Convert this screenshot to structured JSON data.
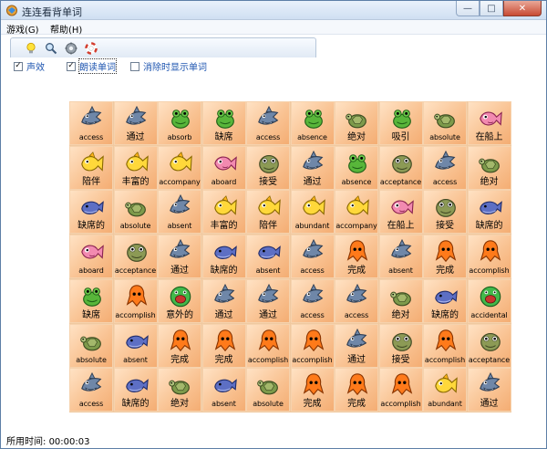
{
  "window": {
    "title": "连连看背单词",
    "controls": {
      "minimize": "—",
      "maximize": "□",
      "close": "✕"
    }
  },
  "menu": [
    {
      "label": "游戏(G)"
    },
    {
      "label": "帮助(H)"
    }
  ],
  "toolbar": [
    {
      "icon": "lightbulb-icon"
    },
    {
      "icon": "magnifier-icon"
    },
    {
      "icon": "gear-icon"
    },
    {
      "icon": "lifebuoy-icon"
    }
  ],
  "options": [
    {
      "label": "声效",
      "checked": true
    },
    {
      "label": "朗读单词",
      "checked": true
    },
    {
      "label": "消除时显示单词",
      "checked": false
    }
  ],
  "board": {
    "rows": [
      [
        {
          "word": "access",
          "creature": "shark"
        },
        {
          "word": "通过",
          "creature": "shark"
        },
        {
          "word": "absorb",
          "creature": "frog"
        },
        {
          "word": "缺席",
          "creature": "frog"
        },
        {
          "word": "access",
          "creature": "shark"
        },
        {
          "word": "absence",
          "creature": "frog"
        },
        {
          "word": "绝对",
          "creature": "turtle"
        },
        {
          "word": "吸引",
          "creature": "frog"
        },
        {
          "word": "absolute",
          "creature": "turtle"
        },
        {
          "word": "在船上",
          "creature": "pinkfish"
        }
      ],
      [
        {
          "word": "陪伴",
          "creature": "yellowfish"
        },
        {
          "word": "丰富的",
          "creature": "yellowfish"
        },
        {
          "word": "accompany",
          "creature": "yellowfish"
        },
        {
          "word": "aboard",
          "creature": "pinkfish"
        },
        {
          "word": "接受",
          "creature": "toad"
        },
        {
          "word": "通过",
          "creature": "shark"
        },
        {
          "word": "absence",
          "creature": "frog"
        },
        {
          "word": "acceptance",
          "creature": "toad"
        },
        {
          "word": "access",
          "creature": "shark"
        },
        {
          "word": "绝对",
          "creature": "turtle"
        }
      ],
      [
        {
          "word": "缺席的",
          "creature": "whale"
        },
        {
          "word": "absolute",
          "creature": "turtle"
        },
        {
          "word": "absent",
          "creature": "shark"
        },
        {
          "word": "丰富的",
          "creature": "yellowfish"
        },
        {
          "word": "陪伴",
          "creature": "yellowfish"
        },
        {
          "word": "abundant",
          "creature": "yellowfish"
        },
        {
          "word": "accompany",
          "creature": "yellowfish"
        },
        {
          "word": "在船上",
          "creature": "pinkfish"
        },
        {
          "word": "接受",
          "creature": "toad"
        },
        {
          "word": "缺席的",
          "creature": "whale"
        }
      ],
      [
        {
          "word": "aboard",
          "creature": "pinkfish"
        },
        {
          "word": "acceptance",
          "creature": "toad"
        },
        {
          "word": "通过",
          "creature": "shark"
        },
        {
          "word": "缺席的",
          "creature": "whale"
        },
        {
          "word": "absent",
          "creature": "whale"
        },
        {
          "word": "access",
          "creature": "shark"
        },
        {
          "word": "完成",
          "creature": "squid"
        },
        {
          "word": "absent",
          "creature": "shark"
        },
        {
          "word": "完成",
          "creature": "squid"
        },
        {
          "word": "accomplish",
          "creature": "squid"
        }
      ],
      [
        {
          "word": "缺席",
          "creature": "frog"
        },
        {
          "word": "accomplish",
          "creature": "squid"
        },
        {
          "word": "意外的",
          "creature": "greenball"
        },
        {
          "word": "通过",
          "creature": "shark"
        },
        {
          "word": "通过",
          "creature": "shark"
        },
        {
          "word": "access",
          "creature": "shark"
        },
        {
          "word": "access",
          "creature": "shark"
        },
        {
          "word": "绝对",
          "creature": "turtle"
        },
        {
          "word": "缺席的",
          "creature": "whale"
        },
        {
          "word": "accidental",
          "creature": "greenball"
        }
      ],
      [
        {
          "word": "absolute",
          "creature": "turtle"
        },
        {
          "word": "absent",
          "creature": "whale"
        },
        {
          "word": "完成",
          "creature": "squid"
        },
        {
          "word": "完成",
          "creature": "squid"
        },
        {
          "word": "accomplish",
          "creature": "squid"
        },
        {
          "word": "accomplish",
          "creature": "squid"
        },
        {
          "word": "通过",
          "creature": "shark"
        },
        {
          "word": "接受",
          "creature": "toad"
        },
        {
          "word": "accomplish",
          "creature": "squid"
        },
        {
          "word": "acceptance",
          "creature": "toad"
        }
      ],
      [
        {
          "word": "access",
          "creature": "shark"
        },
        {
          "word": "缺席的",
          "creature": "whale"
        },
        {
          "word": "绝对",
          "creature": "turtle"
        },
        {
          "word": "absent",
          "creature": "whale"
        },
        {
          "word": "absolute",
          "creature": "turtle"
        },
        {
          "word": "完成",
          "creature": "squid"
        },
        {
          "word": "完成",
          "creature": "squid"
        },
        {
          "word": "accomplish",
          "creature": "squid"
        },
        {
          "word": "abundant",
          "creature": "yellowfish"
        },
        {
          "word": "通过",
          "creature": "shark"
        }
      ]
    ]
  },
  "status": {
    "elapsed_label": "所用时间:",
    "elapsed_value": "00:00:03"
  },
  "colors": {
    "tile_light": "#ffe2c4",
    "tile_dark": "#f4ad73",
    "option_text": "#1e55b0",
    "title_bar": "#cfdff2"
  }
}
